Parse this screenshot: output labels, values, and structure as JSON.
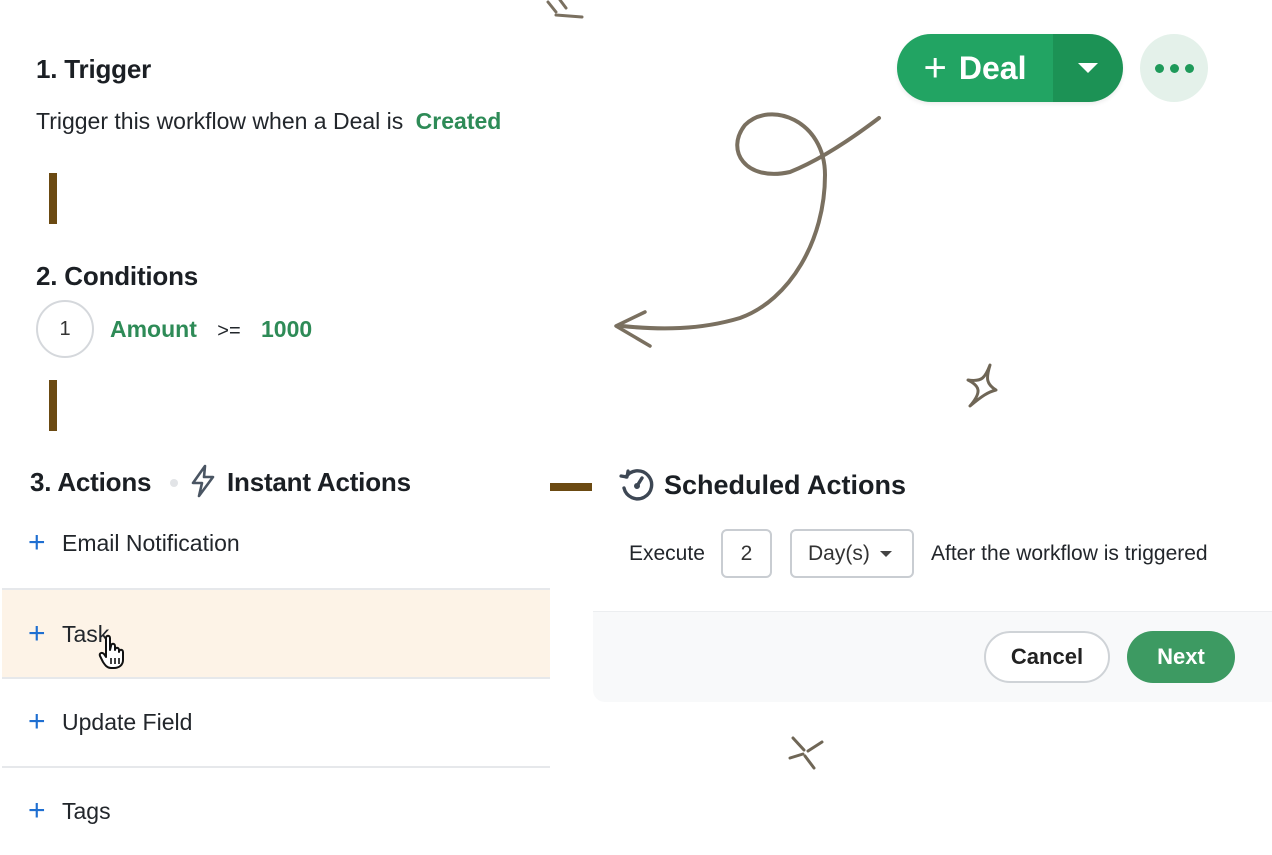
{
  "trigger": {
    "heading": "1. Trigger",
    "text": "Trigger this workflow when a Deal is",
    "event": "Created"
  },
  "conditions": {
    "heading": "2. Conditions",
    "items": [
      {
        "index": "1",
        "field": "Amount",
        "operator": ">=",
        "value": "1000"
      }
    ]
  },
  "actions": {
    "heading": "3. Actions",
    "instant_label": "Instant Actions",
    "items": [
      {
        "label": "Email Notification",
        "highlighted": false
      },
      {
        "label": "Task",
        "highlighted": true
      },
      {
        "label": "Update Field",
        "highlighted": false
      },
      {
        "label": "Tags",
        "highlighted": false
      }
    ]
  },
  "scheduled": {
    "title": "Scheduled Actions",
    "execute_label": "Execute",
    "amount": "2",
    "unit": "Day(s)",
    "suffix": "After the workflow is triggered"
  },
  "buttons": {
    "deal": "Deal",
    "cancel": "Cancel",
    "next": "Next"
  },
  "colors": {
    "accent_green": "#22a463",
    "value_green": "#2e8b57",
    "plus_blue": "#1f6fd1",
    "highlight_row": "#fdf3e7",
    "connector_brown": "#6b4a12"
  }
}
